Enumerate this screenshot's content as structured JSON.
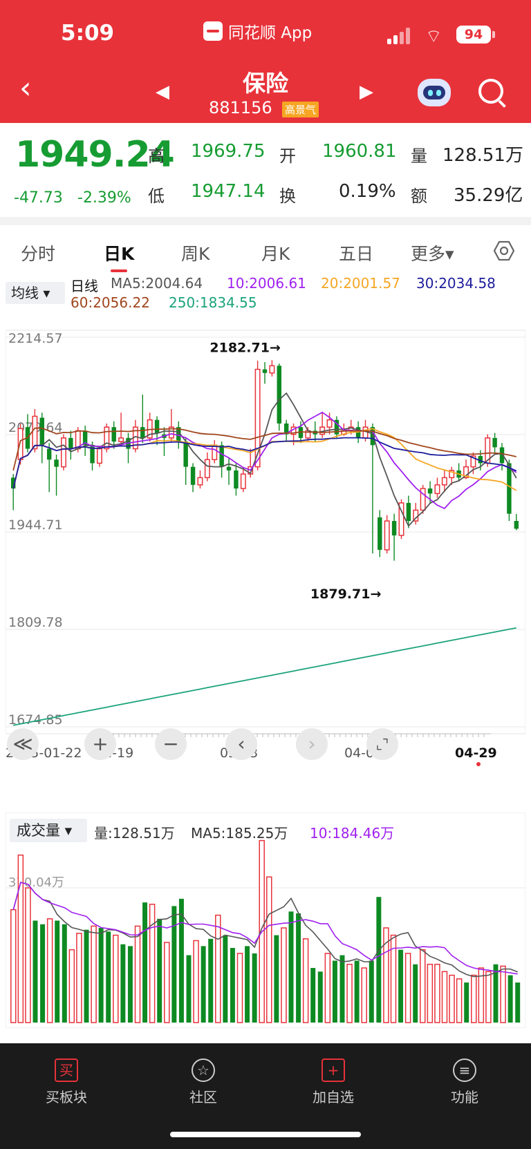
{
  "status": {
    "time": "5:09",
    "app": "同花顺 App",
    "battery": "94"
  },
  "nav": {
    "title": "保险",
    "code": "881156",
    "badge": "高景气"
  },
  "quote": {
    "price": "1949.24",
    "change": "-47.73",
    "change_pct": "-2.39%",
    "high_label": "高",
    "high": "1969.75",
    "open_label": "开",
    "open": "1960.81",
    "vol_label": "量",
    "vol": "128.51万",
    "low_label": "低",
    "low": "1947.14",
    "turnover_label": "换",
    "turnover": "0.19%",
    "amount_label": "额",
    "amount": "35.29亿"
  },
  "tabs": [
    "分时",
    "日K",
    "周K",
    "月K",
    "五日",
    "更多▾"
  ],
  "ma": {
    "select": "均线 ▾",
    "period": "日线",
    "ma5": "MA5:2004.64",
    "ma10": "10:2006.61",
    "ma20": "20:2001.57",
    "ma30": "30:2034.58",
    "ma60": "60:2056.22",
    "ma250": "250:1834.55"
  },
  "volume": {
    "select": "成交量 ▾",
    "vol": "量:128.51万",
    "ma5": "MA5:185.25万",
    "ma10": "10:184.46万",
    "axis_label": "370.04万"
  },
  "colors": {
    "up": "#e8323a",
    "down": "#0e8a22",
    "ma5": "#555555",
    "ma10": "#a020f0",
    "ma20": "#f5a623",
    "ma30": "#1c1c9c",
    "ma60": "#a0451c",
    "ma250": "#1aa37a"
  },
  "chart_data": {
    "type": "candlestick",
    "title": "保险",
    "y_ticks": [
      "2214.57",
      "2079.64",
      "1944.71",
      "1809.78",
      "1674.85"
    ],
    "ylim": [
      1674.85,
      2214.57
    ],
    "x_labels": [
      "2025-01-22",
      "02-19",
      "03-13",
      "04-07",
      "04-29"
    ],
    "annotations": [
      {
        "text": "2182.71→",
        "value": 2182.71
      },
      {
        "text": "1879.71→",
        "value": 1879.71
      }
    ],
    "candles": [
      [
        2020,
        2005,
        2025,
        1975
      ],
      [
        2045,
        2088,
        2095,
        2038
      ],
      [
        2090,
        2060,
        2108,
        2055
      ],
      [
        2060,
        2105,
        2115,
        2055
      ],
      [
        2103,
        2065,
        2110,
        2040
      ],
      [
        2060,
        2045,
        2068,
        2000
      ],
      [
        2045,
        2035,
        2052,
        1995
      ],
      [
        2035,
        2075,
        2080,
        2030
      ],
      [
        2075,
        2060,
        2085,
        2045
      ],
      [
        2060,
        2085,
        2090,
        2055
      ],
      [
        2085,
        2065,
        2092,
        2050
      ],
      [
        2065,
        2040,
        2070,
        2030
      ],
      [
        2040,
        2060,
        2064,
        2035
      ],
      [
        2060,
        2090,
        2095,
        2055
      ],
      [
        2090,
        2070,
        2098,
        2060
      ],
      [
        2070,
        2075,
        2110,
        2065
      ],
      [
        2075,
        2060,
        2082,
        2040
      ],
      [
        2060,
        2090,
        2100,
        2055
      ],
      [
        2090,
        2075,
        2135,
        2068
      ],
      [
        2075,
        2100,
        2110,
        2070
      ],
      [
        2100,
        2082,
        2105,
        2065
      ],
      [
        2080,
        2075,
        2090,
        2050
      ],
      [
        2075,
        2090,
        2115,
        2070
      ],
      [
        2090,
        2070,
        2098,
        2060
      ],
      [
        2070,
        2035,
        2075,
        2010
      ],
      [
        2035,
        2010,
        2040,
        2000
      ],
      [
        2010,
        2020,
        2030,
        2005
      ],
      [
        2020,
        2045,
        2055,
        2015
      ],
      [
        2045,
        2065,
        2072,
        2040
      ],
      [
        2065,
        2035,
        2070,
        2020
      ],
      [
        2035,
        2030,
        2048,
        2010
      ],
      [
        2030,
        2005,
        2040,
        1995
      ],
      [
        2005,
        2025,
        2035,
        2000
      ],
      [
        2025,
        2035,
        2060,
        2020
      ],
      [
        2035,
        2170,
        2182,
        2030
      ],
      [
        2170,
        2165,
        2180,
        2150
      ],
      [
        2165,
        2175,
        2182.71,
        2160
      ],
      [
        2175,
        2095,
        2178,
        2085
      ],
      [
        2095,
        2080,
        2100,
        2070
      ],
      [
        2080,
        2090,
        2095,
        2065
      ],
      [
        2090,
        2075,
        2098,
        2068
      ],
      [
        2075,
        2085,
        2090,
        2070
      ],
      [
        2085,
        2080,
        2098,
        2070
      ],
      [
        2080,
        2090,
        2110,
        2075
      ],
      [
        2090,
        2100,
        2110,
        2080
      ],
      [
        2100,
        2080,
        2105,
        2075
      ],
      [
        2080,
        2085,
        2095,
        2078
      ],
      [
        2085,
        2090,
        2100,
        2080
      ],
      [
        2090,
        2075,
        2098,
        2068
      ],
      [
        2075,
        2090,
        2100,
        2070
      ],
      [
        2090,
        2065,
        2095,
        1915
      ],
      [
        1965,
        1920,
        1975,
        1910
      ],
      [
        1920,
        1960,
        1968,
        1915
      ],
      [
        1960,
        1940,
        1970,
        1905
      ],
      [
        1940,
        1985,
        1990,
        1935
      ],
      [
        1985,
        1960,
        1995,
        1950
      ],
      [
        1960,
        1975,
        1985,
        1955
      ],
      [
        1975,
        2005,
        2010,
        1970
      ],
      [
        2005,
        1998,
        2015,
        1985
      ],
      [
        1998,
        2010,
        2020,
        1992
      ],
      [
        2010,
        2020,
        2030,
        2000
      ],
      [
        2020,
        2030,
        2035,
        2010
      ],
      [
        2030,
        2020,
        2040,
        2015
      ],
      [
        2020,
        2035,
        2045,
        2018
      ],
      [
        2035,
        2050,
        2055,
        2025
      ],
      [
        2050,
        2040,
        2058,
        2030
      ],
      [
        2040,
        2075,
        2080,
        2035
      ],
      [
        2075,
        2062,
        2082,
        2055
      ],
      [
        2062,
        2040,
        2068,
        2030
      ],
      [
        2040,
        1970,
        2045,
        1960
      ],
      [
        1960,
        1949.24,
        1969.75,
        1947.14
      ]
    ],
    "ma250_range": [
      1677,
      1812
    ],
    "volume": [
      [
        310,
        1
      ],
      [
        460,
        1
      ],
      [
        370,
        1
      ],
      [
        280,
        0
      ],
      [
        270,
        0
      ],
      [
        285,
        1
      ],
      [
        280,
        0
      ],
      [
        270,
        0
      ],
      [
        200,
        1
      ],
      [
        245,
        1
      ],
      [
        255,
        0
      ],
      [
        265,
        1
      ],
      [
        260,
        0
      ],
      [
        250,
        0
      ],
      [
        240,
        1
      ],
      [
        215,
        0
      ],
      [
        210,
        0
      ],
      [
        265,
        1
      ],
      [
        330,
        0
      ],
      [
        325,
        1
      ],
      [
        285,
        0
      ],
      [
        220,
        1
      ],
      [
        320,
        0
      ],
      [
        340,
        0
      ],
      [
        185,
        0
      ],
      [
        225,
        1
      ],
      [
        210,
        0
      ],
      [
        230,
        0
      ],
      [
        295,
        1
      ],
      [
        240,
        0
      ],
      [
        205,
        0
      ],
      [
        190,
        1
      ],
      [
        210,
        0
      ],
      [
        190,
        0
      ],
      [
        500,
        1
      ],
      [
        400,
        1
      ],
      [
        240,
        0
      ],
      [
        260,
        1
      ],
      [
        305,
        0
      ],
      [
        300,
        0
      ],
      [
        230,
        1
      ],
      [
        150,
        0
      ],
      [
        140,
        0
      ],
      [
        190,
        1
      ],
      [
        170,
        0
      ],
      [
        185,
        0
      ],
      [
        160,
        1
      ],
      [
        170,
        0
      ],
      [
        150,
        1
      ],
      [
        170,
        0
      ],
      [
        345,
        0
      ],
      [
        260,
        1
      ],
      [
        240,
        1
      ],
      [
        200,
        0
      ],
      [
        190,
        1
      ],
      [
        160,
        0
      ],
      [
        200,
        1
      ],
      [
        160,
        1
      ],
      [
        160,
        1
      ],
      [
        140,
        1
      ],
      [
        130,
        1
      ],
      [
        120,
        1
      ],
      [
        110,
        0
      ],
      [
        130,
        1
      ],
      [
        150,
        1
      ],
      [
        140,
        1
      ],
      [
        160,
        0
      ],
      [
        155,
        1
      ],
      [
        130,
        0
      ],
      [
        110,
        0
      ]
    ]
  },
  "toolbar": {
    "rewind": "≪",
    "zoom_in": "+",
    "zoom_out": "−",
    "prev": "‹",
    "next": "›",
    "fullscreen": "⌞⌝"
  },
  "bottom": {
    "buy": "买板块",
    "community": "社区",
    "add": "加自选",
    "func": "功能",
    "buy_icon": "买",
    "add_icon": "+",
    "func_icon": "≡"
  }
}
